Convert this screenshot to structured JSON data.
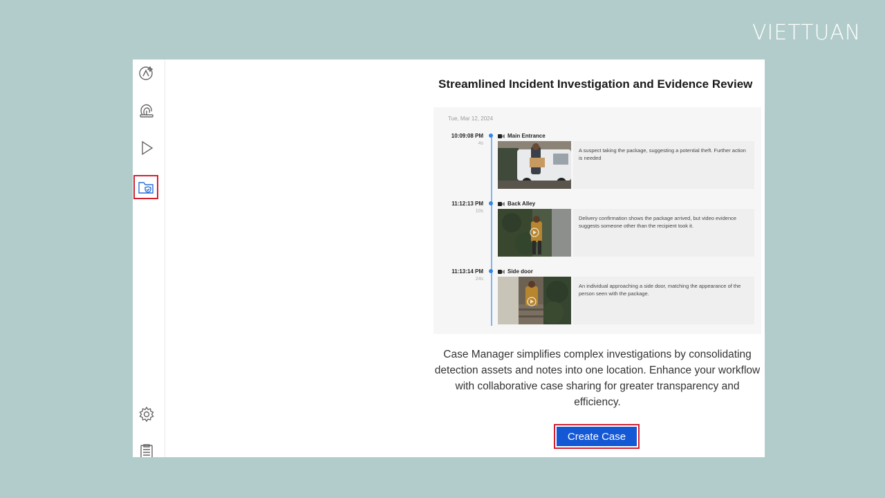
{
  "brand": {
    "text": "VIETTUAN"
  },
  "sidebar": {
    "items": [
      {
        "name": "analytics-icon"
      },
      {
        "name": "face-search-icon"
      },
      {
        "name": "play-icon"
      },
      {
        "name": "case-folder-icon",
        "active": true
      },
      {
        "name": "settings-icon"
      },
      {
        "name": "clipboard-icon"
      }
    ]
  },
  "main": {
    "title": "Streamlined Incident Investigation and Evidence Review",
    "timeline": {
      "date": "Tue, Mar 12, 2024",
      "events": [
        {
          "time": "10:09:08 PM",
          "duration": "4s",
          "camera": "Main Entrance",
          "note": "A suspect taking the package, suggesting a potential theft. Further action is needed"
        },
        {
          "time": "11:12:13 PM",
          "duration": "10s",
          "camera": "Back Alley",
          "note": "Delivery confirmation shows the package arrived, but video evidence suggests someone other than the recipient took it."
        },
        {
          "time": "11:13:14 PM",
          "duration": "24s",
          "camera": "Side door",
          "note": "An individual approaching a side door, matching the appearance of the person seen with the package."
        }
      ]
    },
    "description": "Case Manager simplifies complex investigations by consolidating detection assets and notes into one location. Enhance your workflow with collaborative case sharing for greater transparency and efficiency.",
    "create_button_label": "Create Case"
  },
  "colors": {
    "background": "#b2cccc",
    "accent": "#1458d6",
    "highlight": "#d3202f",
    "timeline": "#7fb2ee"
  }
}
